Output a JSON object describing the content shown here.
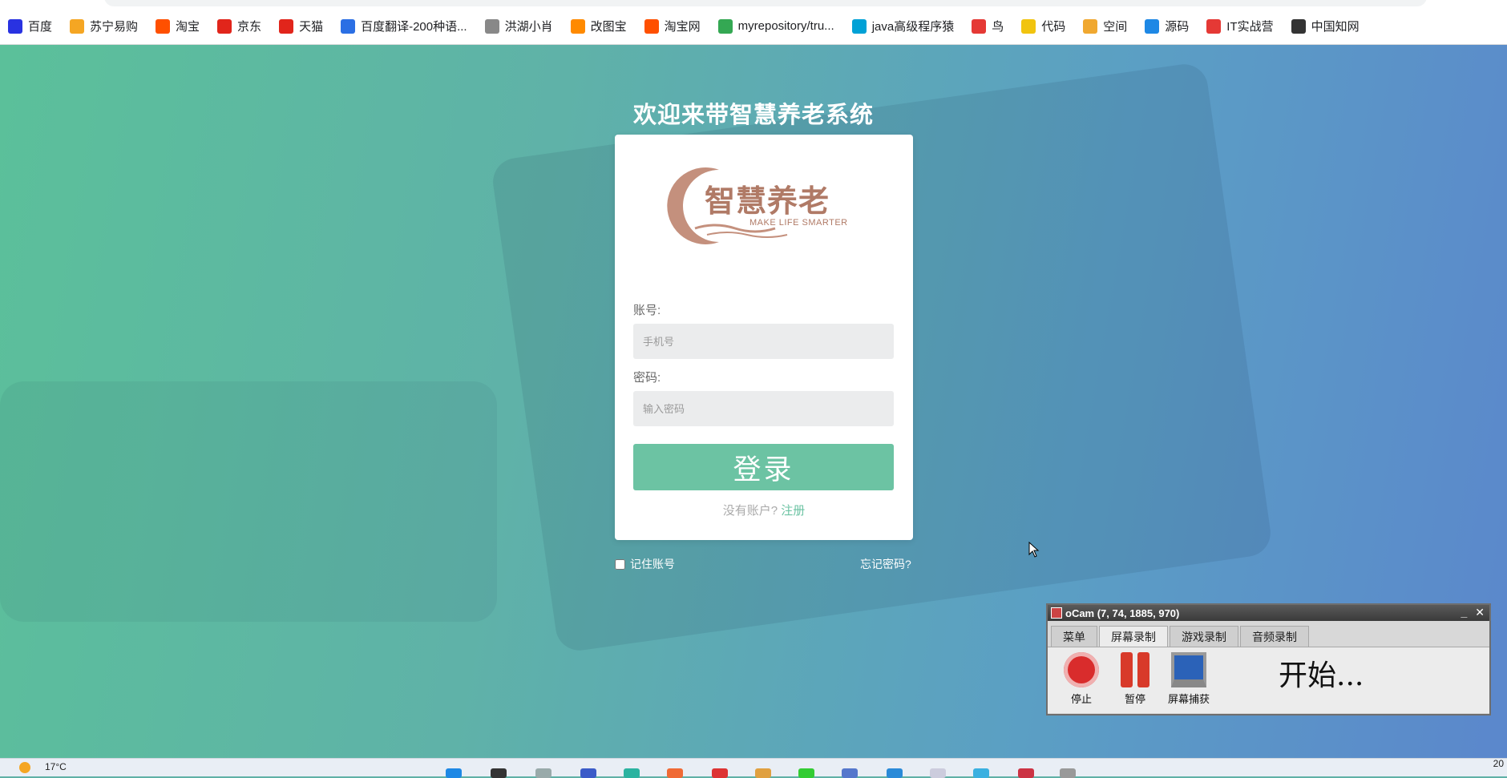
{
  "bookmarks": [
    {
      "label": "百度",
      "icon": "baidu-paw-icon",
      "color": "#2932e1"
    },
    {
      "label": "苏宁易购",
      "icon": "suning-icon",
      "color": "#f5a623"
    },
    {
      "label": "淘宝",
      "icon": "taobao-icon",
      "color": "#ff5000"
    },
    {
      "label": "京东",
      "icon": "jd-icon",
      "color": "#e1251b"
    },
    {
      "label": "天猫",
      "icon": "tmall-icon",
      "color": "#e1251b"
    },
    {
      "label": "百度翻译-200种语...",
      "icon": "translate-icon",
      "color": "#2b6fe4"
    },
    {
      "label": "洪湖小肖",
      "icon": "feather-icon",
      "color": "#888888"
    },
    {
      "label": "改图宝",
      "icon": "gaitubao-icon",
      "color": "#ff8a00"
    },
    {
      "label": "淘宝网",
      "icon": "taobao-icon",
      "color": "#ff5000"
    },
    {
      "label": "myrepository/tru...",
      "icon": "chrome-icon",
      "color": "#34a853"
    },
    {
      "label": "java高级程序猿",
      "icon": "bilibili-icon",
      "color": "#00a1d6"
    },
    {
      "label": "鸟",
      "icon": "bird-icon",
      "color": "#e53935"
    },
    {
      "label": "代码",
      "icon": "code-icon",
      "color": "#f1c40f"
    },
    {
      "label": "空间",
      "icon": "qzone-icon",
      "color": "#f0a830"
    },
    {
      "label": "源码",
      "icon": "source-icon",
      "color": "#1e88e5"
    },
    {
      "label": "IT实战营",
      "icon": "chrome-icon",
      "color": "#e53935"
    },
    {
      "label": "中国知网",
      "icon": "cnki-icon",
      "color": "#333333"
    }
  ],
  "page": {
    "title": "欢迎来带智慧养老系统"
  },
  "logo": {
    "cn": "智慧养老",
    "en": "MAKE LIFE SMARTER"
  },
  "form": {
    "account_label": "账号:",
    "account_placeholder": "手机号",
    "password_label": "密码:",
    "password_placeholder": "输入密码",
    "login_button": "登录",
    "no_account_text": "没有账户?",
    "register_link": "注册",
    "remember_label": "记住账号",
    "forgot_link": "忘记密码?"
  },
  "ocam": {
    "title": "oCam (7, 74, 1885, 970)",
    "minimize": "_",
    "close": "✕",
    "tabs": [
      "菜单",
      "屏幕录制",
      "游戏录制",
      "音频录制"
    ],
    "active_tab": "屏幕录制",
    "tools": {
      "stop": "停止",
      "pause": "暂停",
      "capture": "屏幕捕获"
    },
    "status": "开始..."
  },
  "taskbar": {
    "weather": "17°C",
    "clock": "20"
  },
  "colors": {
    "accent": "#6cc3a3",
    "gradient_start": "#5bc09a",
    "gradient_end": "#5b87cc"
  }
}
